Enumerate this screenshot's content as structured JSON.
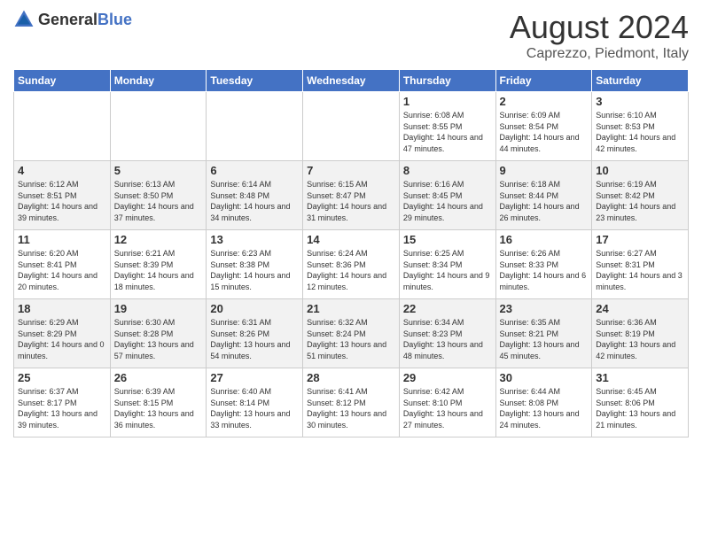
{
  "logo": {
    "general": "General",
    "blue": "Blue"
  },
  "title": "August 2024",
  "location": "Caprezzo, Piedmont, Italy",
  "days_of_week": [
    "Sunday",
    "Monday",
    "Tuesday",
    "Wednesday",
    "Thursday",
    "Friday",
    "Saturday"
  ],
  "weeks": [
    [
      {
        "day": "",
        "info": ""
      },
      {
        "day": "",
        "info": ""
      },
      {
        "day": "",
        "info": ""
      },
      {
        "day": "",
        "info": ""
      },
      {
        "day": "1",
        "info": "Sunrise: 6:08 AM\nSunset: 8:55 PM\nDaylight: 14 hours\nand 47 minutes."
      },
      {
        "day": "2",
        "info": "Sunrise: 6:09 AM\nSunset: 8:54 PM\nDaylight: 14 hours\nand 44 minutes."
      },
      {
        "day": "3",
        "info": "Sunrise: 6:10 AM\nSunset: 8:53 PM\nDaylight: 14 hours\nand 42 minutes."
      }
    ],
    [
      {
        "day": "4",
        "info": "Sunrise: 6:12 AM\nSunset: 8:51 PM\nDaylight: 14 hours\nand 39 minutes."
      },
      {
        "day": "5",
        "info": "Sunrise: 6:13 AM\nSunset: 8:50 PM\nDaylight: 14 hours\nand 37 minutes."
      },
      {
        "day": "6",
        "info": "Sunrise: 6:14 AM\nSunset: 8:48 PM\nDaylight: 14 hours\nand 34 minutes."
      },
      {
        "day": "7",
        "info": "Sunrise: 6:15 AM\nSunset: 8:47 PM\nDaylight: 14 hours\nand 31 minutes."
      },
      {
        "day": "8",
        "info": "Sunrise: 6:16 AM\nSunset: 8:45 PM\nDaylight: 14 hours\nand 29 minutes."
      },
      {
        "day": "9",
        "info": "Sunrise: 6:18 AM\nSunset: 8:44 PM\nDaylight: 14 hours\nand 26 minutes."
      },
      {
        "day": "10",
        "info": "Sunrise: 6:19 AM\nSunset: 8:42 PM\nDaylight: 14 hours\nand 23 minutes."
      }
    ],
    [
      {
        "day": "11",
        "info": "Sunrise: 6:20 AM\nSunset: 8:41 PM\nDaylight: 14 hours\nand 20 minutes."
      },
      {
        "day": "12",
        "info": "Sunrise: 6:21 AM\nSunset: 8:39 PM\nDaylight: 14 hours\nand 18 minutes."
      },
      {
        "day": "13",
        "info": "Sunrise: 6:23 AM\nSunset: 8:38 PM\nDaylight: 14 hours\nand 15 minutes."
      },
      {
        "day": "14",
        "info": "Sunrise: 6:24 AM\nSunset: 8:36 PM\nDaylight: 14 hours\nand 12 minutes."
      },
      {
        "day": "15",
        "info": "Sunrise: 6:25 AM\nSunset: 8:34 PM\nDaylight: 14 hours\nand 9 minutes."
      },
      {
        "day": "16",
        "info": "Sunrise: 6:26 AM\nSunset: 8:33 PM\nDaylight: 14 hours\nand 6 minutes."
      },
      {
        "day": "17",
        "info": "Sunrise: 6:27 AM\nSunset: 8:31 PM\nDaylight: 14 hours\nand 3 minutes."
      }
    ],
    [
      {
        "day": "18",
        "info": "Sunrise: 6:29 AM\nSunset: 8:29 PM\nDaylight: 14 hours\nand 0 minutes."
      },
      {
        "day": "19",
        "info": "Sunrise: 6:30 AM\nSunset: 8:28 PM\nDaylight: 13 hours\nand 57 minutes."
      },
      {
        "day": "20",
        "info": "Sunrise: 6:31 AM\nSunset: 8:26 PM\nDaylight: 13 hours\nand 54 minutes."
      },
      {
        "day": "21",
        "info": "Sunrise: 6:32 AM\nSunset: 8:24 PM\nDaylight: 13 hours\nand 51 minutes."
      },
      {
        "day": "22",
        "info": "Sunrise: 6:34 AM\nSunset: 8:23 PM\nDaylight: 13 hours\nand 48 minutes."
      },
      {
        "day": "23",
        "info": "Sunrise: 6:35 AM\nSunset: 8:21 PM\nDaylight: 13 hours\nand 45 minutes."
      },
      {
        "day": "24",
        "info": "Sunrise: 6:36 AM\nSunset: 8:19 PM\nDaylight: 13 hours\nand 42 minutes."
      }
    ],
    [
      {
        "day": "25",
        "info": "Sunrise: 6:37 AM\nSunset: 8:17 PM\nDaylight: 13 hours\nand 39 minutes."
      },
      {
        "day": "26",
        "info": "Sunrise: 6:39 AM\nSunset: 8:15 PM\nDaylight: 13 hours\nand 36 minutes."
      },
      {
        "day": "27",
        "info": "Sunrise: 6:40 AM\nSunset: 8:14 PM\nDaylight: 13 hours\nand 33 minutes."
      },
      {
        "day": "28",
        "info": "Sunrise: 6:41 AM\nSunset: 8:12 PM\nDaylight: 13 hours\nand 30 minutes."
      },
      {
        "day": "29",
        "info": "Sunrise: 6:42 AM\nSunset: 8:10 PM\nDaylight: 13 hours\nand 27 minutes."
      },
      {
        "day": "30",
        "info": "Sunrise: 6:44 AM\nSunset: 8:08 PM\nDaylight: 13 hours\nand 24 minutes."
      },
      {
        "day": "31",
        "info": "Sunrise: 6:45 AM\nSunset: 8:06 PM\nDaylight: 13 hours\nand 21 minutes."
      }
    ]
  ]
}
